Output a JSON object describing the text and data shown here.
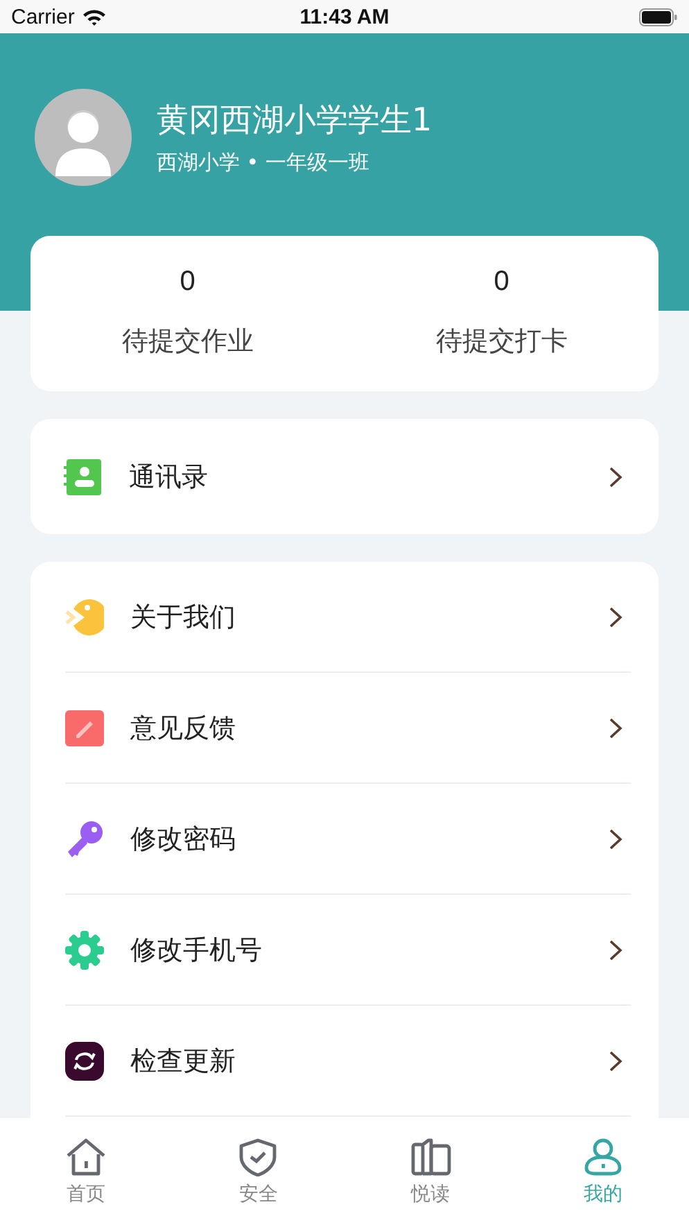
{
  "status_bar": {
    "carrier": "Carrier",
    "time": "11:43 AM"
  },
  "profile": {
    "name": "黄冈西湖小学学生1",
    "school": "西湖小学 • 一年级一班"
  },
  "stats": [
    {
      "value": "0",
      "label": "待提交作业"
    },
    {
      "value": "0",
      "label": "待提交打卡"
    }
  ],
  "contacts": {
    "label": "通讯录"
  },
  "menu": [
    {
      "label": "关于我们"
    },
    {
      "label": "意见反馈"
    },
    {
      "label": "修改密码"
    },
    {
      "label": "修改手机号"
    },
    {
      "label": "检查更新"
    }
  ],
  "tabs": [
    {
      "label": "首页",
      "selected": false
    },
    {
      "label": "安全",
      "selected": false
    },
    {
      "label": "悦读",
      "selected": false
    },
    {
      "label": "我的",
      "selected": true
    }
  ]
}
